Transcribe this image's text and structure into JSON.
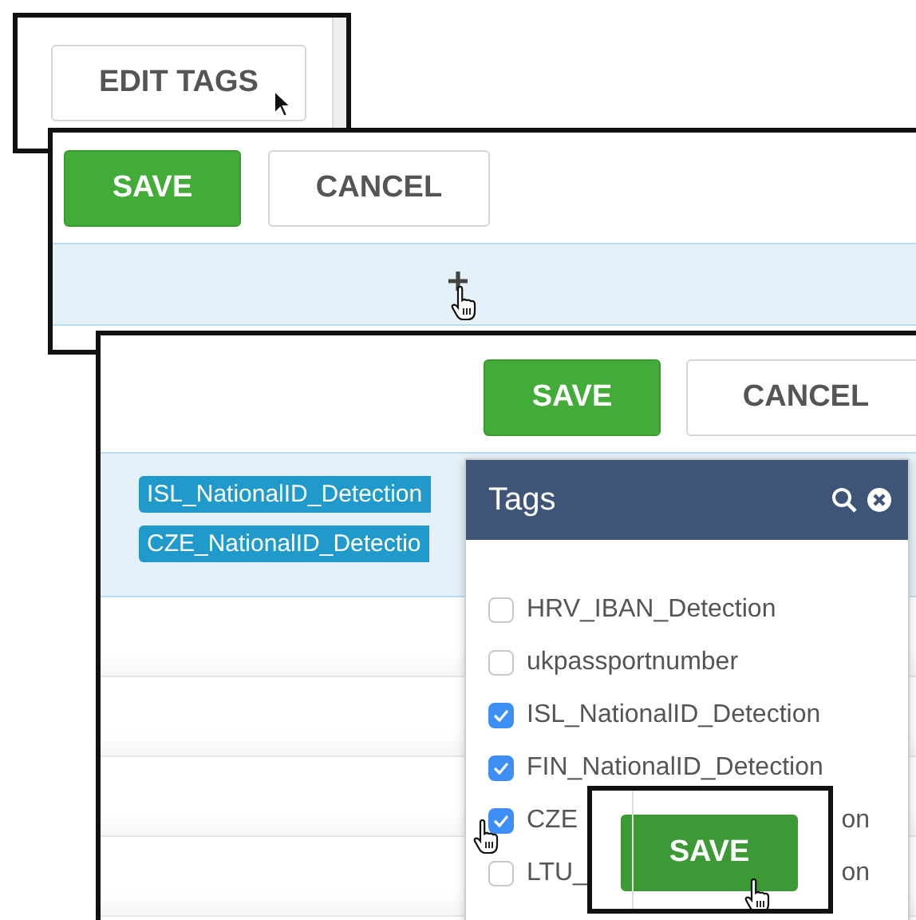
{
  "step1": {
    "button": {
      "label": "EDIT TAGS",
      "kind": "secondary"
    }
  },
  "step2": {
    "buttons": [
      {
        "label": "SAVE",
        "kind": "primary"
      },
      {
        "label": "CANCEL",
        "kind": "secondary"
      }
    ]
  },
  "step3": {
    "buttons": [
      {
        "label": "SAVE",
        "kind": "primary"
      },
      {
        "label": "CANCEL",
        "kind": "secondary"
      }
    ],
    "tags": [
      "ISL_NationalID_Detection",
      "CZE_NationalID_Detectio"
    ],
    "popup": {
      "title": "Tags",
      "items": [
        {
          "label": "HRV_IBAN_Detection",
          "checked": false
        },
        {
          "label": "ukpassportnumber",
          "checked": false
        },
        {
          "label": "ISL_NationalID_Detection",
          "checked": true
        },
        {
          "label": "FIN_NationalID_Detection",
          "checked": true
        },
        {
          "label": "CZE",
          "tail": "on",
          "checked": true
        },
        {
          "label": "LTU_",
          "tail": "on",
          "checked": false
        }
      ]
    }
  },
  "step4": {
    "button": {
      "label": "SAVE",
      "kind": "primary"
    }
  }
}
